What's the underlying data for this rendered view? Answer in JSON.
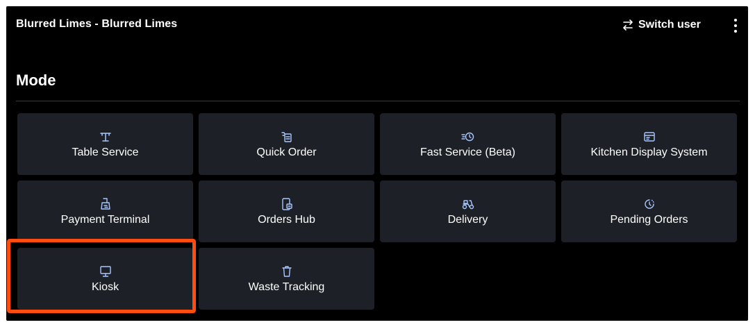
{
  "header": {
    "title": "Blurred Limes - Blurred Limes",
    "switch_user_label": "Switch user",
    "switch_icon": "swap-arrows-icon",
    "menu_icon": "more-vertical-icon"
  },
  "section": {
    "title": "Mode"
  },
  "tiles": [
    {
      "label": "Table Service",
      "icon": "table-icon"
    },
    {
      "label": "Quick Order",
      "icon": "quick-order-icon"
    },
    {
      "label": "Fast Service (Beta)",
      "icon": "fast-service-icon"
    },
    {
      "label": "Kitchen Display System",
      "icon": "kitchen-display-icon"
    },
    {
      "label": "Payment Terminal",
      "icon": "payment-terminal-icon"
    },
    {
      "label": "Orders Hub",
      "icon": "orders-hub-icon"
    },
    {
      "label": "Delivery",
      "icon": "delivery-scooter-icon"
    },
    {
      "label": "Pending Orders",
      "icon": "clock-icon"
    },
    {
      "label": "Kiosk",
      "icon": "kiosk-monitor-icon",
      "highlighted": true
    },
    {
      "label": "Waste Tracking",
      "icon": "trash-icon"
    }
  ],
  "colors": {
    "background": "#000000",
    "tile": "#1d2027",
    "icon_accent": "#a9c7ff",
    "highlight": "#ff4d0f"
  }
}
